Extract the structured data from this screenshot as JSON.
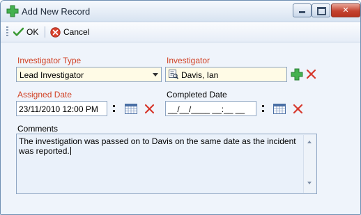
{
  "window": {
    "title": "Add New Record",
    "icon": "green-plus-icon",
    "controls": [
      "minimize-icon",
      "maximize-icon",
      "close-icon"
    ]
  },
  "toolbar": {
    "ok_label": "OK",
    "ok_icon": "checkmark-icon",
    "cancel_label": "Cancel",
    "cancel_icon": "cancel-circle-icon"
  },
  "form": {
    "investigator_type": {
      "label": "Investigator Type",
      "value": "Lead Investigator",
      "required": true
    },
    "investigator": {
      "label": "Investigator",
      "value": "Davis, Ian",
      "required": true
    },
    "assigned_date": {
      "label": "Assigned Date",
      "value": "23/11/2010 12:00 PM",
      "required": true
    },
    "completed_date": {
      "label": "Completed Date",
      "value": "__/__/____ __:__ __",
      "required": false
    },
    "comments": {
      "label": "Comments",
      "value": "The investigation was passed on to Davis on the same date as the incident was reported."
    }
  },
  "colors": {
    "required_label": "#d14124",
    "add_green": "#3aa54a",
    "delete_red": "#d6372b",
    "field_highlight": "#fffbe6"
  }
}
